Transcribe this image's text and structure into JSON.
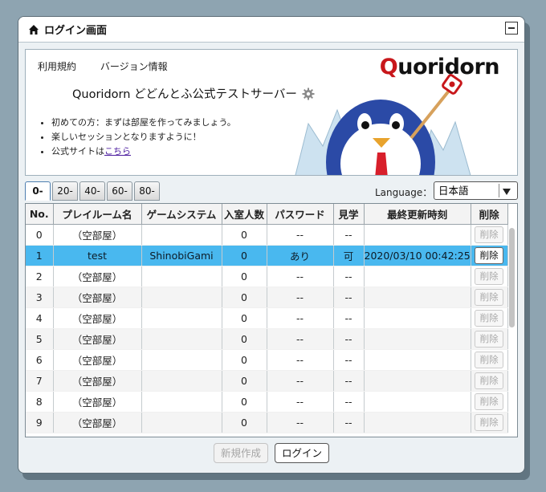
{
  "window": {
    "title": "ログイン画面"
  },
  "banner": {
    "links": [
      "利用規約",
      "バージョン情報"
    ],
    "server_title": "Quoridorn どどんとふ公式テストサーバー",
    "notes": [
      "初めての方：まずは部屋を作ってみましょう。",
      "楽しいセッションとなりますように！"
    ],
    "note_site_prefix": "公式サイトは",
    "note_site_link": "こちら",
    "logo_q": "Q",
    "logo_rest": "uoridorn"
  },
  "tabs": [
    "0-",
    "20-",
    "40-",
    "60-",
    "80-"
  ],
  "language": {
    "label": "Language：",
    "value": "日本語"
  },
  "table": {
    "headers": [
      "No.",
      "プレイルーム名",
      "ゲームシステム",
      "入室人数",
      "パスワード",
      "見学",
      "最終更新時刻",
      "削除"
    ],
    "rows": [
      {
        "no": "0",
        "name": "（空部屋）",
        "system": "",
        "members": "0",
        "password": "--",
        "visit": "--",
        "updated": "",
        "delete": "削除"
      },
      {
        "no": "1",
        "name": "test",
        "system": "ShinobiGami",
        "members": "0",
        "password": "あり",
        "visit": "可",
        "updated": "2020/03/10 00:42:25",
        "delete": "削除"
      },
      {
        "no": "2",
        "name": "（空部屋）",
        "system": "",
        "members": "0",
        "password": "--",
        "visit": "--",
        "updated": "",
        "delete": "削除"
      },
      {
        "no": "3",
        "name": "（空部屋）",
        "system": "",
        "members": "0",
        "password": "--",
        "visit": "--",
        "updated": "",
        "delete": "削除"
      },
      {
        "no": "4",
        "name": "（空部屋）",
        "system": "",
        "members": "0",
        "password": "--",
        "visit": "--",
        "updated": "",
        "delete": "削除"
      },
      {
        "no": "5",
        "name": "（空部屋）",
        "system": "",
        "members": "0",
        "password": "--",
        "visit": "--",
        "updated": "",
        "delete": "削除"
      },
      {
        "no": "6",
        "name": "（空部屋）",
        "system": "",
        "members": "0",
        "password": "--",
        "visit": "--",
        "updated": "",
        "delete": "削除"
      },
      {
        "no": "7",
        "name": "（空部屋）",
        "system": "",
        "members": "0",
        "password": "--",
        "visit": "--",
        "updated": "",
        "delete": "削除"
      },
      {
        "no": "8",
        "name": "（空部屋）",
        "system": "",
        "members": "0",
        "password": "--",
        "visit": "--",
        "updated": "",
        "delete": "削除"
      },
      {
        "no": "9",
        "name": "（空部屋）",
        "system": "",
        "members": "0",
        "password": "--",
        "visit": "--",
        "updated": "",
        "delete": "削除"
      }
    ]
  },
  "buttons": {
    "create": "新規作成",
    "login": "ログイン"
  }
}
